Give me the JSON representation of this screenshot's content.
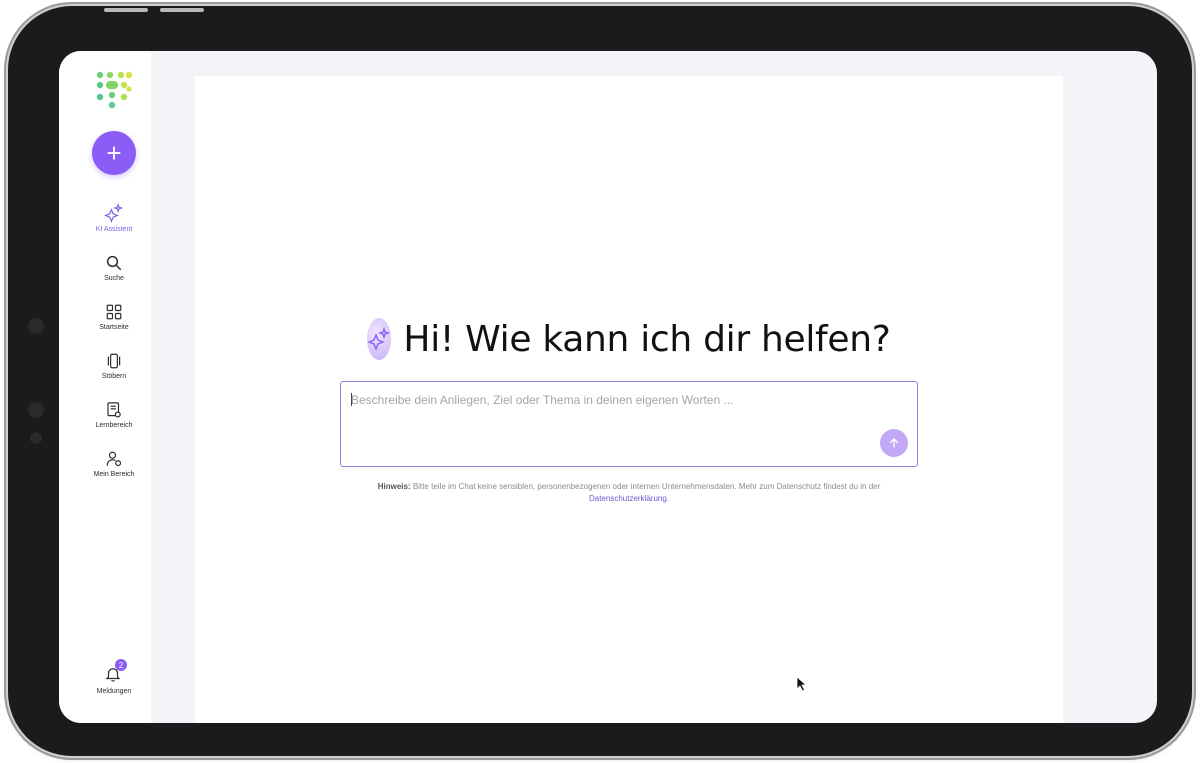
{
  "sidebar": {
    "new_button_label": "+",
    "items": [
      {
        "label": "KI Assistent",
        "icon": "sparkles-icon",
        "active": true
      },
      {
        "label": "Suche",
        "icon": "search-icon"
      },
      {
        "label": "Startseite",
        "icon": "grid-icon"
      },
      {
        "label": "Stöbern",
        "icon": "carousel-icon"
      },
      {
        "label": "Lernbereich",
        "icon": "certificate-icon"
      },
      {
        "label": "Mein Bereich",
        "icon": "user-settings-icon"
      }
    ],
    "notifications": {
      "label": "Meldungen",
      "badge": "2",
      "icon": "bell-icon"
    }
  },
  "main": {
    "greeting": "Hi! Wie kann ich dir helfen?",
    "chat": {
      "placeholder": "Beschreibe dein Anliegen, Ziel oder Thema in deinen eigenen Worten ...",
      "send_icon": "arrow-up-icon"
    },
    "hint": {
      "prefix": "Hinweis:",
      "text": " Bitte teile im Chat keine sensiblen, personenbezogenen oder internen Unternehmensdaten. Mehr zum Datenschutz findest du in der ",
      "link": "Datenschutzerklärung",
      "suffix": "."
    }
  },
  "colors": {
    "accent": "#8b5cf6",
    "accent_light": "#c3a9f5",
    "link": "#6d5bd0",
    "logo_green": "#6ccf7a",
    "logo_yellow": "#d8e34a"
  }
}
